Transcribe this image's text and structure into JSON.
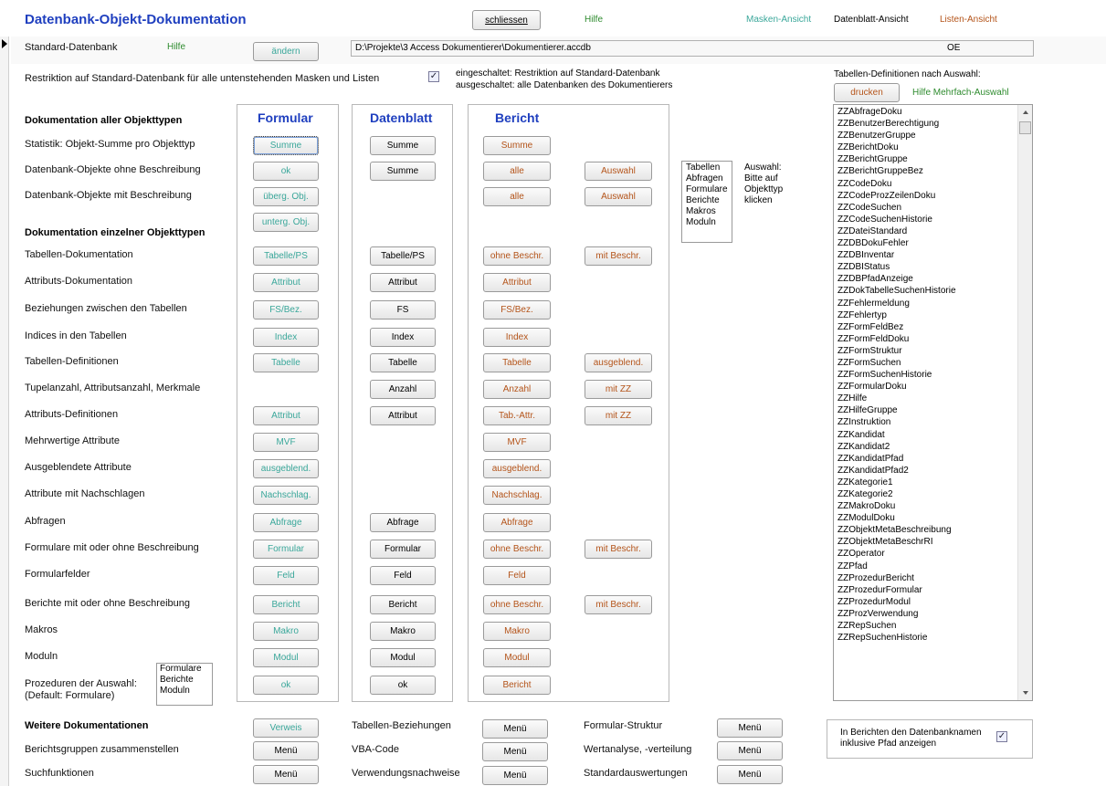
{
  "header": {
    "title": "Datenbank-Objekt-Dokumentation",
    "close_label": "schliessen",
    "help": "Hilfe",
    "view_form": "Masken-Ansicht",
    "view_datasheet": "Datenblatt-Ansicht",
    "view_list": "Listen-Ansicht"
  },
  "standard": {
    "label": "Standard-Datenbank",
    "help": "Hilfe",
    "change_label": "ändern",
    "path": "D:\\Projekte\\3 Access Dokumentierer\\Dokumentierer.accdb",
    "code": "OE",
    "restriction_label": "Restriktion auf Standard-Datenbank für alle untenstehenden Masken und Listen",
    "restriction_checked": true,
    "restriction_on": "eingeschaltet: Restriktion auf Standard-Datenbank",
    "restriction_off": "ausgeschaltet: alle Datenbanken des Dokumentierers"
  },
  "columns": {
    "formular": "Formular",
    "datenblatt": "Datenblatt",
    "bericht": "Bericht"
  },
  "sections": {
    "all_types": "Dokumentation aller Objekttypen",
    "single_types": "Dokumentation einzelner Objekttypen",
    "further": "Weitere Dokumentationen"
  },
  "rows": [
    {
      "label": "Statistik: Objekt-Summe pro Objekttyp",
      "form": "Summe",
      "data": "Summe",
      "rep": "Summe",
      "extra": ""
    },
    {
      "label": "Datenbank-Objekte ohne Beschreibung",
      "form": "ok",
      "data": "Summe",
      "rep": "alle",
      "extra": "Auswahl"
    },
    {
      "label": "Datenbank-Objekte mit Beschreibung",
      "form": "überg. Obj.",
      "data": "",
      "rep": "alle",
      "extra": "Auswahl"
    },
    {
      "label": "",
      "form": "unterg. Obj.",
      "data": "",
      "rep": "",
      "extra": ""
    },
    {
      "label": "Tabellen-Dokumentation",
      "form": "Tabelle/PS",
      "data": "Tabelle/PS",
      "rep": "ohne Beschr.",
      "extra": "mit Beschr."
    },
    {
      "label": "Attributs-Dokumentation",
      "form": "Attribut",
      "data": "Attribut",
      "rep": "Attribut",
      "extra": ""
    },
    {
      "label": "Beziehungen zwischen den Tabellen",
      "form": "FS/Bez.",
      "data": "FS",
      "rep": "FS/Bez.",
      "extra": ""
    },
    {
      "label": "Indices in den Tabellen",
      "form": "Index",
      "data": "Index",
      "rep": "Index",
      "extra": ""
    },
    {
      "label": "Tabellen-Definitionen",
      "form": "Tabelle",
      "data": "Tabelle",
      "rep": "Tabelle",
      "extra": "ausgeblend."
    },
    {
      "label": "Tupelanzahl, Attributsanzahl, Merkmale",
      "form": "",
      "data": "Anzahl",
      "rep": "Anzahl",
      "extra": "mit ZZ"
    },
    {
      "label": "Attributs-Definitionen",
      "form": "Attribut",
      "data": "Attribut",
      "rep": "Tab.-Attr.",
      "extra": "mit ZZ"
    },
    {
      "label": "Mehrwertige Attribute",
      "form": "MVF",
      "data": "",
      "rep": "MVF",
      "extra": ""
    },
    {
      "label": "Ausgeblendete Attribute",
      "form": "ausgeblend.",
      "data": "",
      "rep": "ausgeblend.",
      "extra": ""
    },
    {
      "label": "Attribute mit Nachschlagen",
      "form": "Nachschlag.",
      "data": "",
      "rep": "Nachschlag.",
      "extra": ""
    },
    {
      "label": "Abfragen",
      "form": "Abfrage",
      "data": "Abfrage",
      "rep": "Abfrage",
      "extra": ""
    },
    {
      "label": "Formulare mit oder ohne Beschreibung",
      "form": "Formular",
      "data": "Formular",
      "rep": "ohne Beschr.",
      "extra": "mit Beschr."
    },
    {
      "label": "Formularfelder",
      "form": "Feld",
      "data": "Feld",
      "rep": "Feld",
      "extra": ""
    },
    {
      "label": "Berichte mit oder ohne Beschreibung",
      "form": "Bericht",
      "data": "Bericht",
      "rep": "ohne Beschr.",
      "extra": "mit Beschr."
    },
    {
      "label": "Makros",
      "form": "Makro",
      "data": "Makro",
      "rep": "Makro",
      "extra": ""
    },
    {
      "label": "Moduln",
      "form": "Modul",
      "data": "Modul",
      "rep": "Modul",
      "extra": ""
    },
    {
      "label": "Prozeduren der Auswahl:",
      "form": "ok",
      "data": "ok",
      "rep": "Bericht",
      "extra": ""
    }
  ],
  "procedures_default": "(Default: Formulare)",
  "procedure_types": [
    "Formulare",
    "Berichte",
    "Moduln"
  ],
  "object_types": [
    "Tabellen",
    "Abfragen",
    "Formulare",
    "Berichte",
    "Makros",
    "Moduln"
  ],
  "selection_hint": [
    "Auswahl:",
    "Bitte auf",
    "Objekttyp",
    "klicken"
  ],
  "further": {
    "row1": {
      "label": "Weitere Dokumentationen",
      "btn1": "Verweis",
      "label2": "Tabellen-Beziehungen",
      "btn2": "Menü",
      "label3": "Formular-Struktur",
      "btn3": "Menü"
    },
    "row2": {
      "label": "Berichtsgruppen zusammenstellen",
      "btn1": "Menü",
      "label2": "VBA-Code",
      "btn2": "Menü",
      "label3": "Wertanalyse, -verteilung",
      "btn3": "Menü"
    },
    "row3": {
      "label": "Suchfunktionen",
      "btn1": "Menü",
      "label2": "Verwendungsnachweise",
      "btn2": "Menü",
      "label3": "Standardauswertungen",
      "btn3": "Menü"
    }
  },
  "tables_panel": {
    "title": "Tabellen-Definitionen nach Auswahl:",
    "print_label": "drucken",
    "help_multi": "Hilfe Mehrfach-Auswahl",
    "items": [
      "ZZAbfrageDoku",
      "ZZBenutzerBerechtigung",
      "ZZBenutzerGruppe",
      "ZZBerichtDoku",
      "ZZBerichtGruppe",
      "ZZBerichtGruppeBez",
      "ZZCodeDoku",
      "ZZCodeProzZeilenDoku",
      "ZZCodeSuchen",
      "ZZCodeSuchenHistorie",
      "ZZDateiStandard",
      "ZZDBDokuFehler",
      "ZZDBInventar",
      "ZZDBIStatus",
      "ZZDBPfadAnzeige",
      "ZZDokTabelleSuchenHistorie",
      "ZZFehlermeldung",
      "ZZFehlertyp",
      "ZZFormFeldBez",
      "ZZFormFeldDoku",
      "ZZFormStruktur",
      "ZZFormSuchen",
      "ZZFormSuchenHistorie",
      "ZZFormularDoku",
      "ZZHilfe",
      "ZZHilfeGruppe",
      "ZZInstruktion",
      "ZZKandidat",
      "ZZKandidat2",
      "ZZKandidatPfad",
      "ZZKandidatPfad2",
      "ZZKategorie1",
      "ZZKategorie2",
      "ZZMakroDoku",
      "ZZModulDoku",
      "ZZObjektMetaBeschreibung",
      "ZZObjektMetaBeschrRI",
      "ZZOperator",
      "ZZPfad",
      "ZZProzedurBericht",
      "ZZProzedurFormular",
      "ZZProzedurModul",
      "ZZProzVerwendung",
      "ZZRepSuchen",
      "ZZRepSuchenHistorie"
    ]
  },
  "path_option": {
    "line1": "In Berichten den Datenbanknamen",
    "line2": "inklusive Pfad anzeigen",
    "checked": true
  }
}
